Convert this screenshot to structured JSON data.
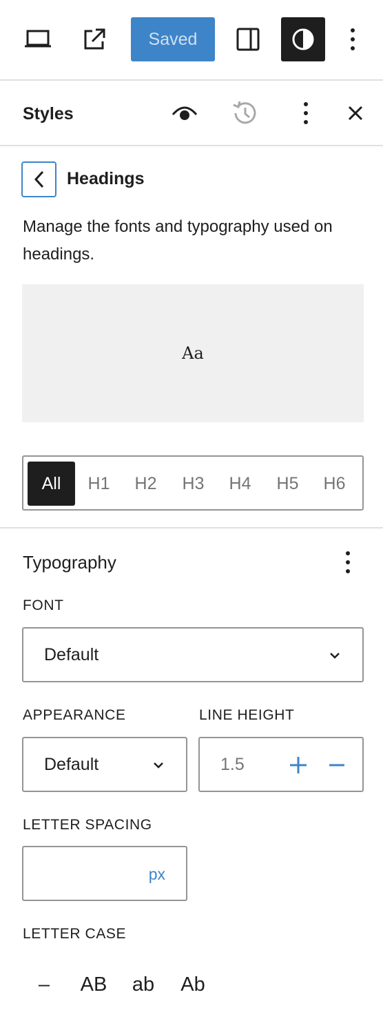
{
  "toolbar": {
    "view_icon": "laptop-icon",
    "external_icon": "external-link-icon",
    "saved_label": "Saved",
    "sidebar_icon": "sidebar-toggle-icon",
    "styles_icon": "contrast-icon",
    "more_icon": "more-vertical-icon",
    "accent_color": "#3e84c8"
  },
  "styles_panel": {
    "title": "Styles",
    "icons": [
      "eye-icon",
      "history-icon",
      "more-vertical-icon",
      "close-icon"
    ]
  },
  "headings": {
    "title": "Headings",
    "description": "Manage the fonts and typography used on headings.",
    "preview_text": "Aa",
    "levels": [
      "All",
      "H1",
      "H2",
      "H3",
      "H4",
      "H5",
      "H6"
    ],
    "active_level": "All"
  },
  "typography": {
    "title": "Typography",
    "font_label": "FONT",
    "font_value": "Default",
    "appearance_label": "APPEARANCE",
    "appearance_value": "Default",
    "line_height_label": "LINE HEIGHT",
    "line_height_value": "1.5",
    "letter_spacing_label": "LETTER SPACING",
    "letter_spacing_unit": "px",
    "letter_case_label": "LETTER CASE",
    "letter_case_options": [
      "–",
      "AB",
      "ab",
      "Ab"
    ]
  }
}
